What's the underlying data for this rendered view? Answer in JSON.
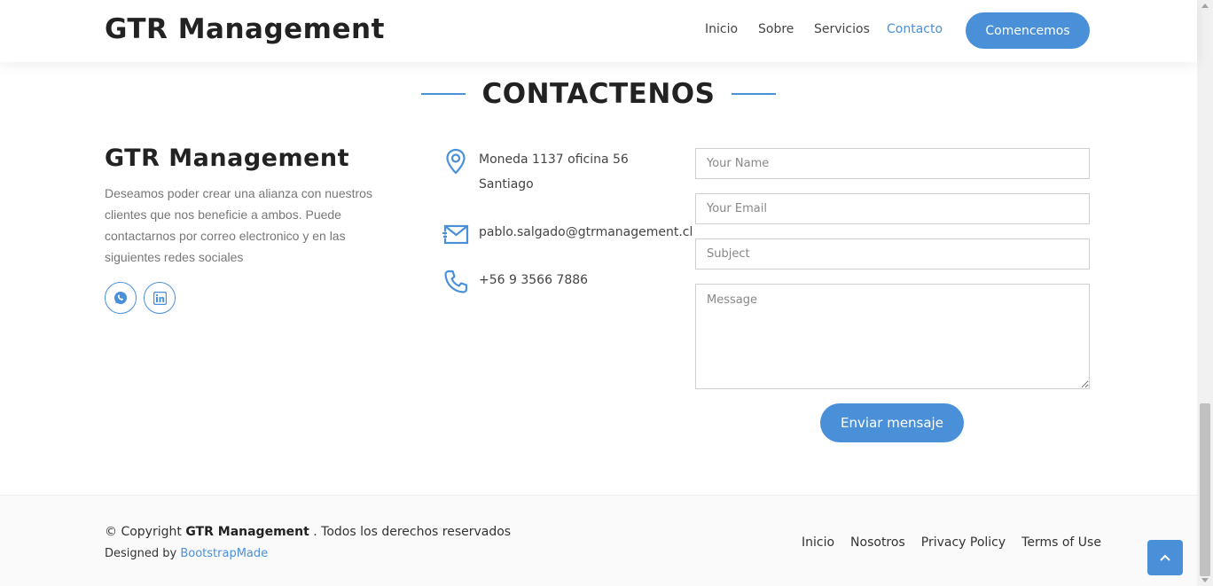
{
  "header": {
    "logo": "GTR Management",
    "nav": [
      {
        "label": "Inicio",
        "active": false
      },
      {
        "label": "Sobre",
        "active": false
      },
      {
        "label": "Servicios",
        "active": false
      },
      {
        "label": "Contacto",
        "active": true
      }
    ],
    "cta_label": "Comencemos"
  },
  "section": {
    "title": "CONTACTENOS"
  },
  "info": {
    "title": "GTR Management",
    "description": "Deseamos poder crear una alianza con nuestros clientes que nos beneficie a ambos. Puede contactarnos por correo electronico y en las siguientes redes sociales",
    "social": [
      {
        "name": "whatsapp-icon"
      },
      {
        "name": "linkedin-icon"
      }
    ]
  },
  "contact": {
    "address_line1": "Moneda 1137 oficina 56",
    "address_line2": "Santiago",
    "email": "pablo.salgado@gtrmanagement.cl",
    "phone": "+56 9 3566 7886"
  },
  "form": {
    "name_placeholder": "Your Name",
    "email_placeholder": "Your Email",
    "subject_placeholder": "Subject",
    "message_placeholder": "Message",
    "submit_label": "Enviar mensaje"
  },
  "footer": {
    "copyright_prefix": "© Copyright",
    "copyright_brand": "GTR Management",
    "copyright_suffix": ". Todos los derechos reservados",
    "designed_by": "Designed by",
    "designer": "BootstrapMade",
    "links": [
      "Inicio",
      "Nosotros",
      "Privacy Policy",
      "Terms of Use"
    ]
  },
  "colors": {
    "accent": "#4a90d9",
    "heading": "#222222",
    "muted": "#777777"
  }
}
